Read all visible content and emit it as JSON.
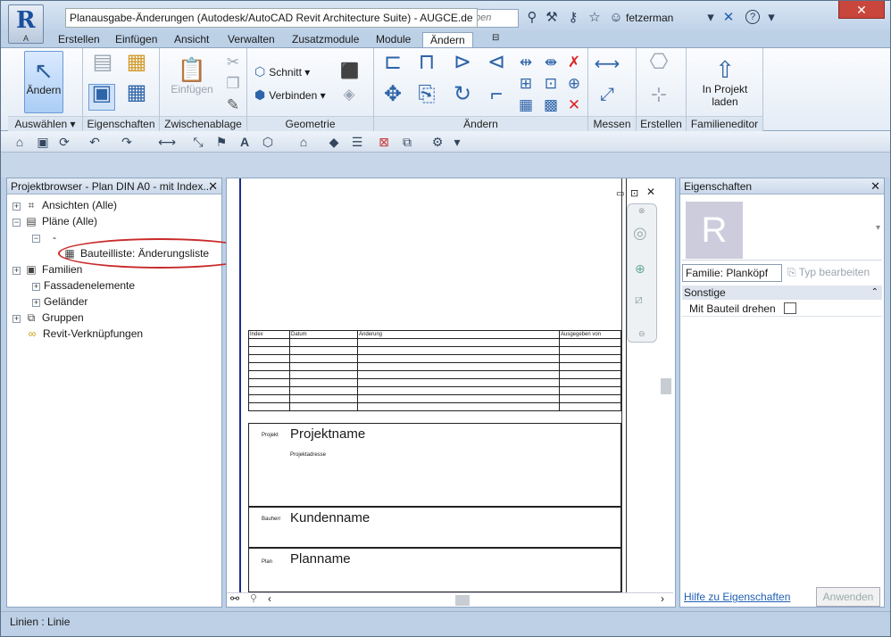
{
  "titlebar": {
    "window_title": "Planausgabe-Änderungen (Autodesk/AutoCAD Revit Architecture Suite) - AUGCE.de",
    "app_letter": "R",
    "app_sub": "A",
    "search_placeholder": "ben",
    "user": "fetzerman",
    "close": "✕"
  },
  "tabs": [
    "Erstellen",
    "Einfügen",
    "Ansicht",
    "Verwalten",
    "Zusatzmodule",
    "Module",
    "Ändern"
  ],
  "ribbon": {
    "panels": {
      "select": "Auswählen ▾",
      "properties": "Eigenschaften",
      "clipboard": "Zwischenablage",
      "geometry": "Geometrie",
      "modify": "Ändern",
      "measure": "Messen",
      "create": "Erstellen",
      "family_editor": "Familieneditor"
    },
    "modify_btn": "Ändern",
    "paste_btn": "Einfügen",
    "cut_btn": "Schnitt",
    "join_btn": "Verbinden",
    "load_btn_1": "In Projekt",
    "load_btn_2": "laden"
  },
  "browser": {
    "title": "Projektbrowser - Plan DIN A0 - mit Index...",
    "items": [
      {
        "label": "Ansichten (Alle)",
        "toggle": "+"
      },
      {
        "label": "Pläne (Alle)",
        "toggle": "−"
      },
      {
        "label": "-",
        "toggle": "−"
      },
      {
        "label": "Bauteilliste: Änderungsliste",
        "toggle": ""
      },
      {
        "label": "Familien",
        "toggle": "+"
      },
      {
        "label": "Fassadenelemente",
        "toggle": "+"
      },
      {
        "label": "Geländer",
        "toggle": "+"
      },
      {
        "label": "Gruppen",
        "toggle": "+"
      },
      {
        "label": "Revit-Verknüpfungen",
        "toggle": ""
      }
    ]
  },
  "sheet": {
    "schedule_headers": [
      "Index",
      "Datum",
      "Änderung",
      "Ausgegeben von"
    ],
    "project_label": "Projekt",
    "project_name": "Projektname",
    "project_address": "Projektadresse",
    "client_label": "Bauherr",
    "client_name": "Kundenname",
    "plan_label": "Plan",
    "plan_name": "Planname"
  },
  "properties": {
    "title": "Eigenschaften",
    "family_select": "Familie: Planköpf",
    "edit_type": "Typ bearbeiten",
    "group": "Sonstige",
    "prop_name": "Mit Bauteil drehen",
    "help_link": "Hilfe zu Eigenschaften",
    "apply": "Anwenden"
  },
  "status": {
    "text": "Linien : Linie"
  }
}
